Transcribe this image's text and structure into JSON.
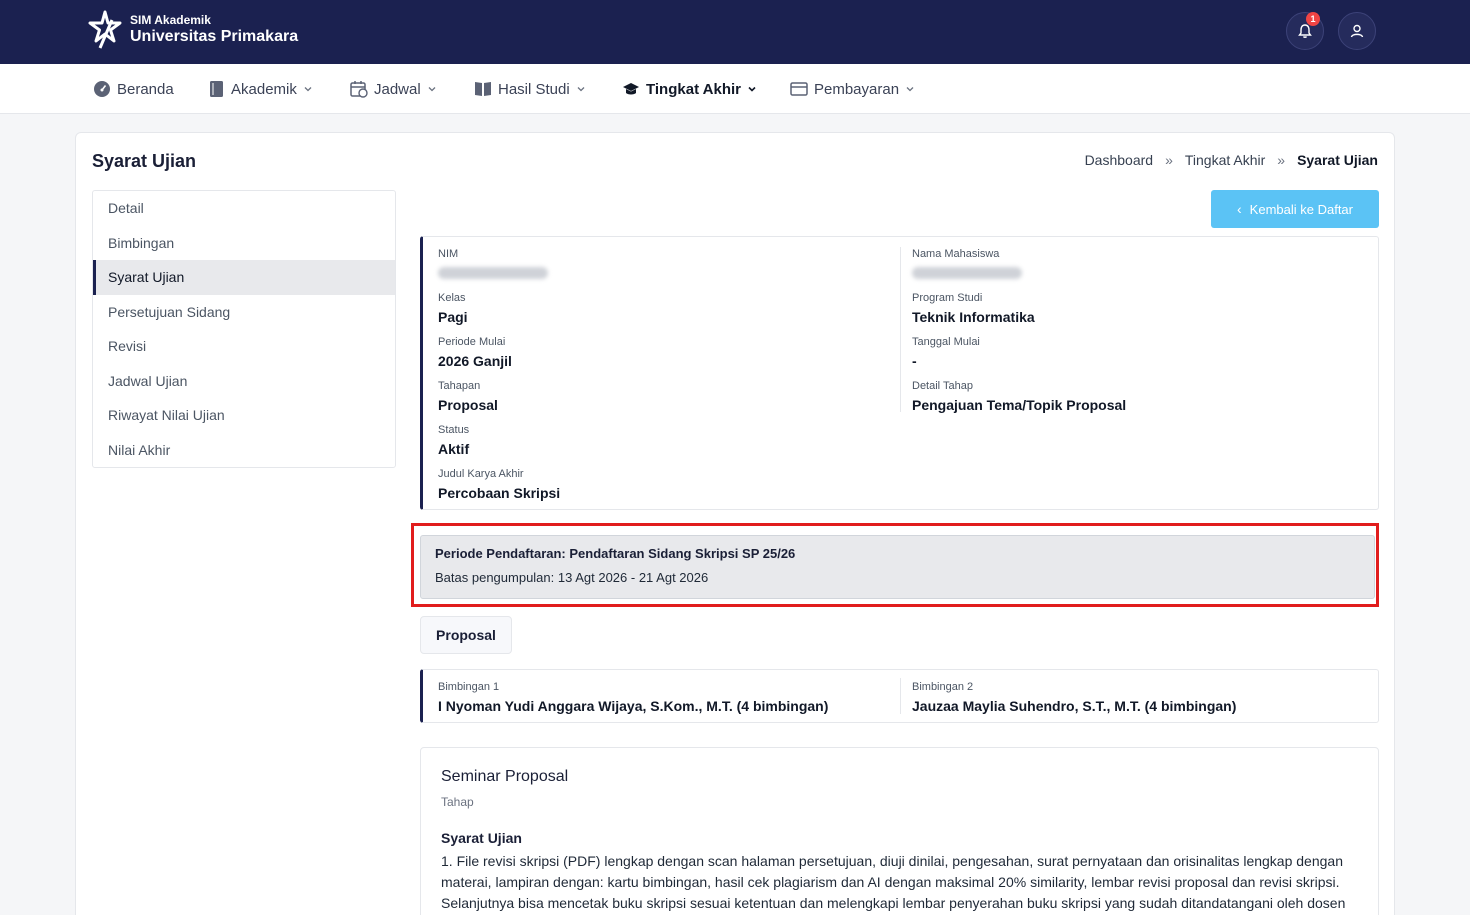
{
  "header": {
    "app_sub": "SIM Akademik",
    "app_name": "Universitas Primakara",
    "notification_count": "1"
  },
  "nav": {
    "items": [
      {
        "label": "Beranda"
      },
      {
        "label": "Akademik"
      },
      {
        "label": "Jadwal"
      },
      {
        "label": "Hasil Studi"
      },
      {
        "label": "Tingkat Akhir"
      },
      {
        "label": "Pembayaran"
      }
    ]
  },
  "page": {
    "title": "Syarat Ujian",
    "breadcrumb": [
      "Dashboard",
      "Tingkat Akhir",
      "Syarat Ujian"
    ],
    "breadcrumb_sep": "»"
  },
  "sidebar": {
    "items": [
      {
        "label": "Detail"
      },
      {
        "label": "Bimbingan"
      },
      {
        "label": "Syarat Ujian"
      },
      {
        "label": "Persetujuan Sidang"
      },
      {
        "label": "Revisi"
      },
      {
        "label": "Jadwal Ujian"
      },
      {
        "label": "Riwayat Nilai Ujian"
      },
      {
        "label": "Nilai Akhir"
      }
    ]
  },
  "actions": {
    "back_label": "Kembali ke Daftar"
  },
  "info": {
    "nim_label": "NIM",
    "nama_label": "Nama Mahasiswa",
    "kelas_label": "Kelas",
    "kelas_value": "Pagi",
    "prodi_label": "Program Studi",
    "prodi_value": "Teknik Informatika",
    "periode_label": "Periode Mulai",
    "periode_value": "2026 Ganjil",
    "tanggal_label": "Tanggal Mulai",
    "tanggal_value": "-",
    "tahapan_label": "Tahapan",
    "tahapan_value": "Proposal",
    "detail_label": "Detail Tahap",
    "detail_value": "Pengajuan Tema/Topik Proposal",
    "status_label": "Status",
    "status_value": "Aktif",
    "judul_label": "Judul Karya Akhir",
    "judul_value": "Percobaan Skripsi"
  },
  "period": {
    "title": "Periode Pendaftaran: Pendaftaran Sidang Skripsi SP 25/26",
    "deadline": "Batas pengumpulan: 13 Agt 2026 - 21 Agt 2026"
  },
  "tab": {
    "label": "Proposal"
  },
  "bimbingan": {
    "b1_label": "Bimbingan 1",
    "b1_value": "I Nyoman Yudi Anggara Wijaya, S.Kom., M.T. (4 bimbingan)",
    "b2_label": "Bimbingan 2",
    "b2_value": "Jauzaa Maylia Suhendro, S.T., M.T. (4 bimbingan)"
  },
  "seminar": {
    "title": "Seminar Proposal",
    "subtitle": "Tahap",
    "req_title": "Syarat Ujian",
    "req_text": "1. File revisi skripsi (PDF) lengkap dengan scan halaman persetujuan, diuji dinilai, pengesahan, surat pernyataan dan orisinalitas lengkap dengan materai, lampiran dengan: kartu bimbingan, hasil cek plagiarism dan AI dengan maksimal 20% similarity, lembar revisi proposal dan revisi skripsi. Selanjutnya bisa mencetak buku skripsi sesuai ketentuan dan melengkapi lembar penyerahan buku skripsi yang sudah ditandatangani oleh dosen"
  }
}
